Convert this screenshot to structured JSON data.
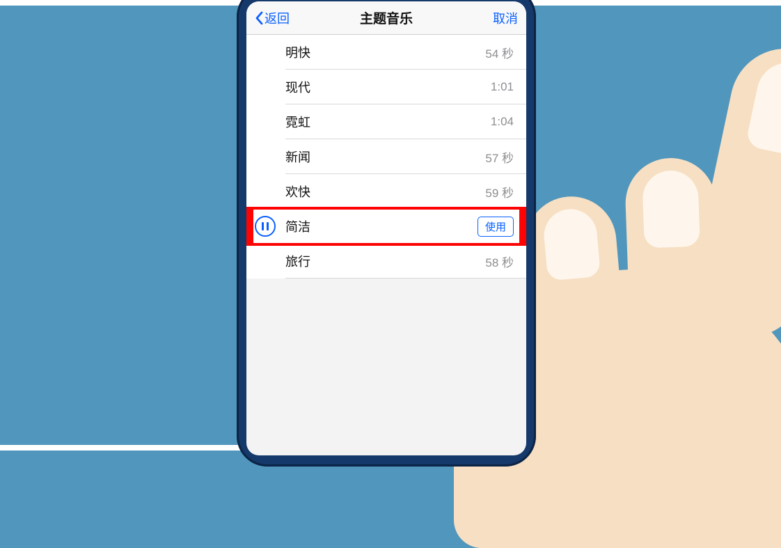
{
  "nav": {
    "back_label": "返回",
    "title": "主题音乐",
    "cancel_label": "取消"
  },
  "music_list": [
    {
      "name": "明快",
      "duration": "54 秒",
      "playing": false
    },
    {
      "name": "现代",
      "duration": "1:01",
      "playing": false
    },
    {
      "name": "霓虹",
      "duration": "1:04",
      "playing": false
    },
    {
      "name": "新闻",
      "duration": "57 秒",
      "playing": false
    },
    {
      "name": "欢快",
      "duration": "59 秒",
      "playing": false
    },
    {
      "name": "简洁",
      "duration": "",
      "playing": true,
      "action_label": "使用"
    },
    {
      "name": "旅行",
      "duration": "58 秒",
      "playing": false
    }
  ],
  "highlight_index": 5,
  "colors": {
    "accent": "#0a60ff",
    "highlight": "#fd0303",
    "background": "#5196bc"
  }
}
